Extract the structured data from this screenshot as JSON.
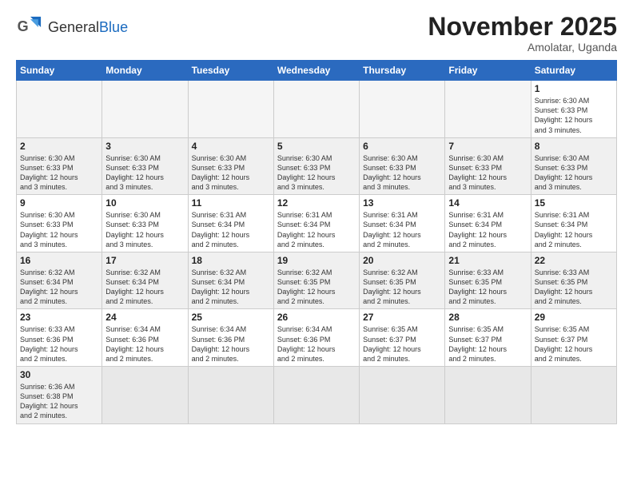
{
  "logo": {
    "text_general": "General",
    "text_blue": "Blue"
  },
  "title": "November 2025",
  "location": "Amolatar, Uganda",
  "days_of_week": [
    "Sunday",
    "Monday",
    "Tuesday",
    "Wednesday",
    "Thursday",
    "Friday",
    "Saturday"
  ],
  "weeks": [
    [
      {
        "day": "",
        "empty": true
      },
      {
        "day": "",
        "empty": true
      },
      {
        "day": "",
        "empty": true
      },
      {
        "day": "",
        "empty": true
      },
      {
        "day": "",
        "empty": true
      },
      {
        "day": "",
        "empty": true
      },
      {
        "day": "1",
        "info": "Sunrise: 6:30 AM\nSunset: 6:33 PM\nDaylight: 12 hours\nand 3 minutes."
      }
    ],
    [
      {
        "day": "2",
        "info": "Sunrise: 6:30 AM\nSunset: 6:33 PM\nDaylight: 12 hours\nand 3 minutes."
      },
      {
        "day": "3",
        "info": "Sunrise: 6:30 AM\nSunset: 6:33 PM\nDaylight: 12 hours\nand 3 minutes."
      },
      {
        "day": "4",
        "info": "Sunrise: 6:30 AM\nSunset: 6:33 PM\nDaylight: 12 hours\nand 3 minutes."
      },
      {
        "day": "5",
        "info": "Sunrise: 6:30 AM\nSunset: 6:33 PM\nDaylight: 12 hours\nand 3 minutes."
      },
      {
        "day": "6",
        "info": "Sunrise: 6:30 AM\nSunset: 6:33 PM\nDaylight: 12 hours\nand 3 minutes."
      },
      {
        "day": "7",
        "info": "Sunrise: 6:30 AM\nSunset: 6:33 PM\nDaylight: 12 hours\nand 3 minutes."
      },
      {
        "day": "8",
        "info": "Sunrise: 6:30 AM\nSunset: 6:33 PM\nDaylight: 12 hours\nand 3 minutes."
      }
    ],
    [
      {
        "day": "9",
        "info": "Sunrise: 6:30 AM\nSunset: 6:33 PM\nDaylight: 12 hours\nand 3 minutes."
      },
      {
        "day": "10",
        "info": "Sunrise: 6:30 AM\nSunset: 6:33 PM\nDaylight: 12 hours\nand 3 minutes."
      },
      {
        "day": "11",
        "info": "Sunrise: 6:31 AM\nSunset: 6:34 PM\nDaylight: 12 hours\nand 2 minutes."
      },
      {
        "day": "12",
        "info": "Sunrise: 6:31 AM\nSunset: 6:34 PM\nDaylight: 12 hours\nand 2 minutes."
      },
      {
        "day": "13",
        "info": "Sunrise: 6:31 AM\nSunset: 6:34 PM\nDaylight: 12 hours\nand 2 minutes."
      },
      {
        "day": "14",
        "info": "Sunrise: 6:31 AM\nSunset: 6:34 PM\nDaylight: 12 hours\nand 2 minutes."
      },
      {
        "day": "15",
        "info": "Sunrise: 6:31 AM\nSunset: 6:34 PM\nDaylight: 12 hours\nand 2 minutes."
      }
    ],
    [
      {
        "day": "16",
        "info": "Sunrise: 6:32 AM\nSunset: 6:34 PM\nDaylight: 12 hours\nand 2 minutes."
      },
      {
        "day": "17",
        "info": "Sunrise: 6:32 AM\nSunset: 6:34 PM\nDaylight: 12 hours\nand 2 minutes."
      },
      {
        "day": "18",
        "info": "Sunrise: 6:32 AM\nSunset: 6:34 PM\nDaylight: 12 hours\nand 2 minutes."
      },
      {
        "day": "19",
        "info": "Sunrise: 6:32 AM\nSunset: 6:35 PM\nDaylight: 12 hours\nand 2 minutes."
      },
      {
        "day": "20",
        "info": "Sunrise: 6:32 AM\nSunset: 6:35 PM\nDaylight: 12 hours\nand 2 minutes."
      },
      {
        "day": "21",
        "info": "Sunrise: 6:33 AM\nSunset: 6:35 PM\nDaylight: 12 hours\nand 2 minutes."
      },
      {
        "day": "22",
        "info": "Sunrise: 6:33 AM\nSunset: 6:35 PM\nDaylight: 12 hours\nand 2 minutes."
      }
    ],
    [
      {
        "day": "23",
        "info": "Sunrise: 6:33 AM\nSunset: 6:36 PM\nDaylight: 12 hours\nand 2 minutes."
      },
      {
        "day": "24",
        "info": "Sunrise: 6:34 AM\nSunset: 6:36 PM\nDaylight: 12 hours\nand 2 minutes."
      },
      {
        "day": "25",
        "info": "Sunrise: 6:34 AM\nSunset: 6:36 PM\nDaylight: 12 hours\nand 2 minutes."
      },
      {
        "day": "26",
        "info": "Sunrise: 6:34 AM\nSunset: 6:36 PM\nDaylight: 12 hours\nand 2 minutes."
      },
      {
        "day": "27",
        "info": "Sunrise: 6:35 AM\nSunset: 6:37 PM\nDaylight: 12 hours\nand 2 minutes."
      },
      {
        "day": "28",
        "info": "Sunrise: 6:35 AM\nSunset: 6:37 PM\nDaylight: 12 hours\nand 2 minutes."
      },
      {
        "day": "29",
        "info": "Sunrise: 6:35 AM\nSunset: 6:37 PM\nDaylight: 12 hours\nand 2 minutes."
      }
    ],
    [
      {
        "day": "30",
        "info": "Sunrise: 6:36 AM\nSunset: 6:38 PM\nDaylight: 12 hours\nand 2 minutes."
      },
      {
        "day": "",
        "empty": true
      },
      {
        "day": "",
        "empty": true
      },
      {
        "day": "",
        "empty": true
      },
      {
        "day": "",
        "empty": true
      },
      {
        "day": "",
        "empty": true
      },
      {
        "day": "",
        "empty": true
      }
    ]
  ]
}
